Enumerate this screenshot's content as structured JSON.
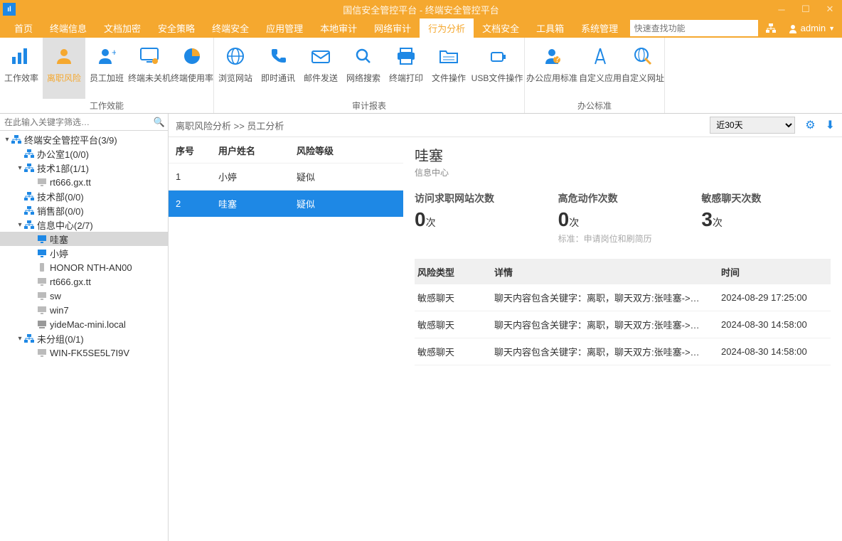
{
  "title": "国信安全管控平台 - 终端安全管控平台",
  "menus": [
    "首页",
    "终端信息",
    "文档加密",
    "安全策略",
    "终端安全",
    "应用管理",
    "本地审计",
    "网络审计",
    "行为分析",
    "文档安全",
    "工具箱",
    "系统管理"
  ],
  "menu_active": 8,
  "search_placeholder": "快速查找功能",
  "user": "admin",
  "ribbon_groups": [
    {
      "label": "工作效能",
      "items": [
        {
          "label": "工作效率",
          "icon": "bar",
          "sel": false
        },
        {
          "label": "离职风险",
          "icon": "person",
          "sel": true
        },
        {
          "label": "员工加班",
          "icon": "person-plus",
          "sel": false
        },
        {
          "label": "终端未关机",
          "icon": "monitor",
          "sel": false
        },
        {
          "label": "终端使用率",
          "icon": "pie",
          "sel": false
        }
      ]
    },
    {
      "label": "审计报表",
      "items": [
        {
          "label": "浏览网站",
          "icon": "globe",
          "sel": false
        },
        {
          "label": "即时通讯",
          "icon": "phone",
          "sel": false
        },
        {
          "label": "邮件发送",
          "icon": "mail",
          "sel": false
        },
        {
          "label": "网络搜索",
          "icon": "search",
          "sel": false
        },
        {
          "label": "终端打印",
          "icon": "print",
          "sel": false
        },
        {
          "label": "文件操作",
          "icon": "folder",
          "sel": false
        },
        {
          "label": "USB文件操作",
          "icon": "usb",
          "sel": false,
          "wide": true
        }
      ]
    },
    {
      "label": "办公标准",
      "items": [
        {
          "label": "办公应用标准",
          "icon": "agent",
          "sel": false,
          "wide": true
        },
        {
          "label": "自定义应用",
          "icon": "compass",
          "sel": false
        },
        {
          "label": "自定义网址",
          "icon": "globe-edit",
          "sel": false
        }
      ]
    }
  ],
  "filter_placeholder": "在此输入关键字筛选…",
  "tree": [
    {
      "d": 0,
      "arrow": "▾",
      "icon": "org",
      "label": "终端安全管控平台(3/9)"
    },
    {
      "d": 1,
      "arrow": "",
      "icon": "org",
      "label": "办公室1(0/0)"
    },
    {
      "d": 1,
      "arrow": "▾",
      "icon": "org",
      "label": "技术1部(1/1)"
    },
    {
      "d": 2,
      "arrow": "",
      "icon": "pc",
      "label": "rt666.gx.tt"
    },
    {
      "d": 1,
      "arrow": "",
      "icon": "org",
      "label": "技术部(0/0)"
    },
    {
      "d": 1,
      "arrow": "",
      "icon": "org",
      "label": "销售部(0/0)"
    },
    {
      "d": 1,
      "arrow": "▾",
      "icon": "org",
      "label": "信息中心(2/7)"
    },
    {
      "d": 2,
      "arrow": "",
      "icon": "pc-on",
      "label": "哇塞",
      "sel": true
    },
    {
      "d": 2,
      "arrow": "",
      "icon": "pc-on",
      "label": "小婷"
    },
    {
      "d": 2,
      "arrow": "",
      "icon": "phone-dev",
      "label": "HONOR NTH-AN00"
    },
    {
      "d": 2,
      "arrow": "",
      "icon": "pc",
      "label": "rt666.gx.tt"
    },
    {
      "d": 2,
      "arrow": "",
      "icon": "pc",
      "label": "sw"
    },
    {
      "d": 2,
      "arrow": "",
      "icon": "pc",
      "label": "win7"
    },
    {
      "d": 2,
      "arrow": "",
      "icon": "mac",
      "label": "yideMac-mini.local"
    },
    {
      "d": 1,
      "arrow": "▾",
      "icon": "org",
      "label": "未分组(0/1)"
    },
    {
      "d": 2,
      "arrow": "",
      "icon": "pc",
      "label": "WIN-FK5SE5L7I9V"
    }
  ],
  "crumb": "离职风险分析  >>  员工分析",
  "period": "近30天",
  "list_hdr": {
    "c1": "序号",
    "c2": "用户姓名",
    "c3": "风险等级"
  },
  "list_rows": [
    {
      "c1": "1",
      "c2": "小婷",
      "c3": "疑似",
      "sel": false
    },
    {
      "c1": "2",
      "c2": "哇塞",
      "c3": "疑似",
      "sel": true
    }
  ],
  "detail": {
    "title": "哇塞",
    "sub": "信息中心"
  },
  "stats": [
    {
      "label": "访问求职网站次数",
      "val": "0",
      "unit": "次",
      "hint": ""
    },
    {
      "label": "高危动作次数",
      "val": "0",
      "unit": "次",
      "hint": "标准：申请岗位和刷简历"
    },
    {
      "label": "敏感聊天次数",
      "val": "3",
      "unit": "次",
      "hint": ""
    }
  ],
  "dtable_hdr": {
    "t1": "风险类型",
    "t2": "详情",
    "t3": "时间"
  },
  "dtable_rows": [
    {
      "t1": "敏感聊天",
      "t2": "聊天内容包含关键字：离职，聊天双方:张哇塞->…",
      "t3": "2024-08-29 17:25:00"
    },
    {
      "t1": "敏感聊天",
      "t2": "聊天内容包含关键字：离职，聊天双方:张哇塞->…",
      "t3": "2024-08-30 14:58:00"
    },
    {
      "t1": "敏感聊天",
      "t2": "聊天内容包含关键字：离职，聊天双方:张哇塞->…",
      "t3": "2024-08-30 14:58:00"
    }
  ]
}
